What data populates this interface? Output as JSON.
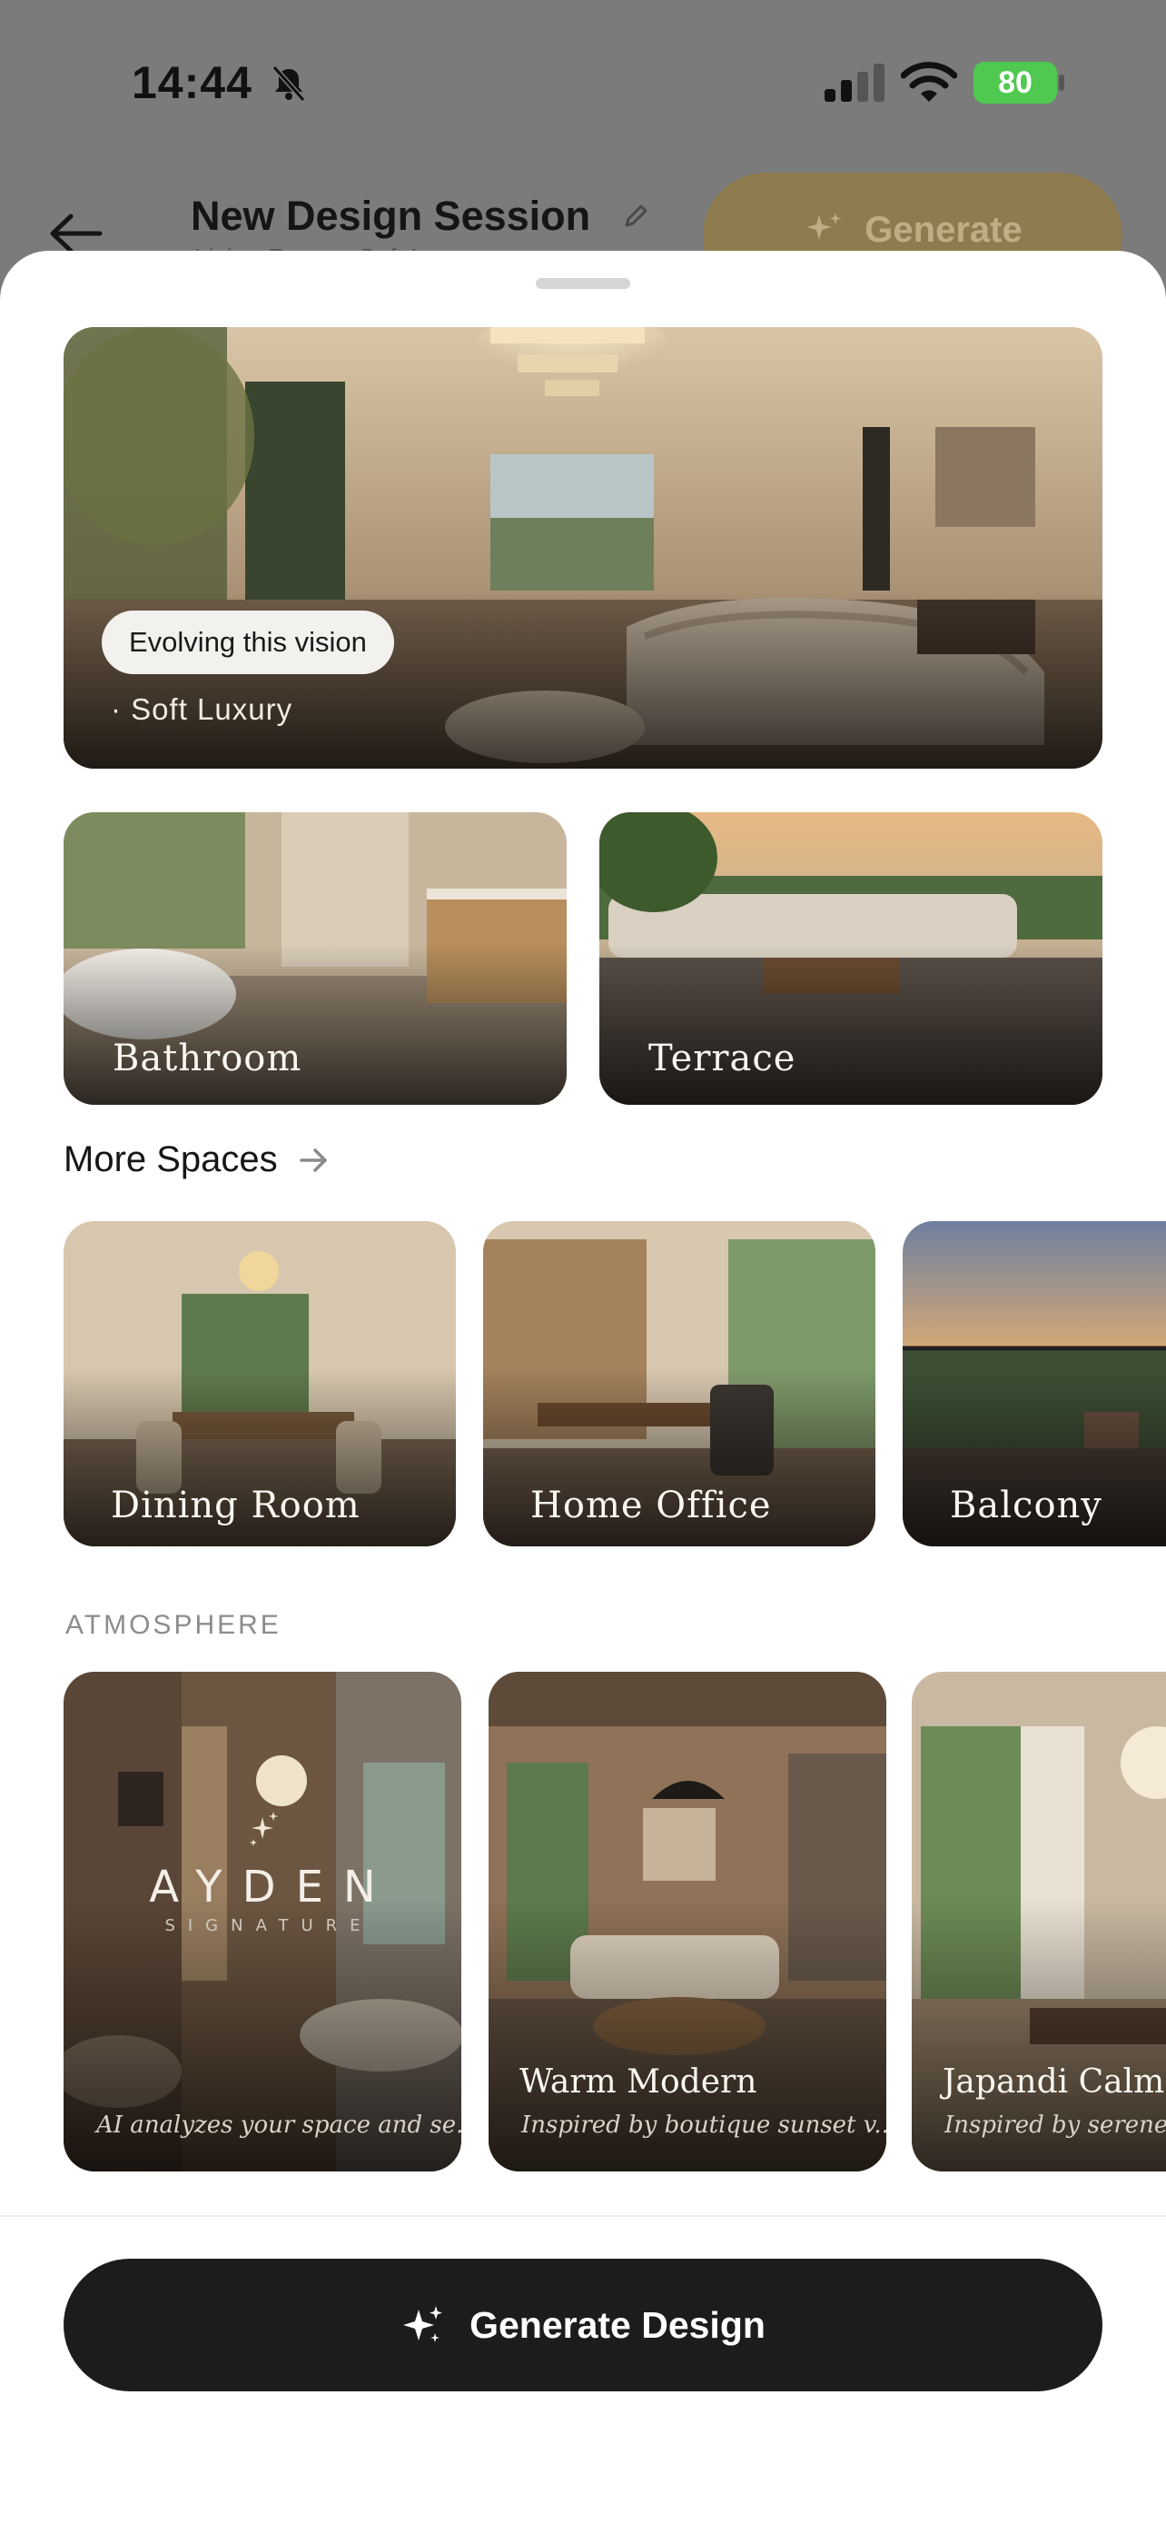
{
  "status_bar": {
    "time": "14:44",
    "battery": "80",
    "icons": [
      "bell-slash-icon",
      "cellular-signal-icon",
      "wifi-icon",
      "battery-charging-icon"
    ]
  },
  "background_header": {
    "title": "New Design Session",
    "subtitle": "Living Room · Soft Luxury",
    "generate_label": "Generate",
    "icons": [
      "back-arrow-icon",
      "pencil-icon",
      "sparkles-icon"
    ]
  },
  "hero": {
    "badge": "Evolving this vision",
    "style_line": "· Soft Luxury"
  },
  "featured_rooms": [
    {
      "label": "Bathroom"
    },
    {
      "label": "Terrace"
    }
  ],
  "more_spaces": {
    "title": "More Spaces",
    "items": [
      {
        "label": "Dining Room"
      },
      {
        "label": "Home Office"
      },
      {
        "label": "Balcony"
      }
    ]
  },
  "atmosphere": {
    "heading": "ATMOSPHERE",
    "brand_word": "AYDEN",
    "brand_sub": "SIGNATURE",
    "items": [
      {
        "title": "",
        "description": "AI analyzes your space and se..."
      },
      {
        "title": "Warm Modern",
        "description": "Inspired by boutique sunset v..."
      },
      {
        "title": "Japandi Calm",
        "description": "Inspired by serene Ky"
      }
    ]
  },
  "cta": {
    "label": "Generate Design",
    "color": "#1c1c1c"
  },
  "colors": {
    "accent_gold": "#8e7b4e",
    "battery_green": "#4fc94f",
    "overlay_gray": "#7b7b7b"
  }
}
